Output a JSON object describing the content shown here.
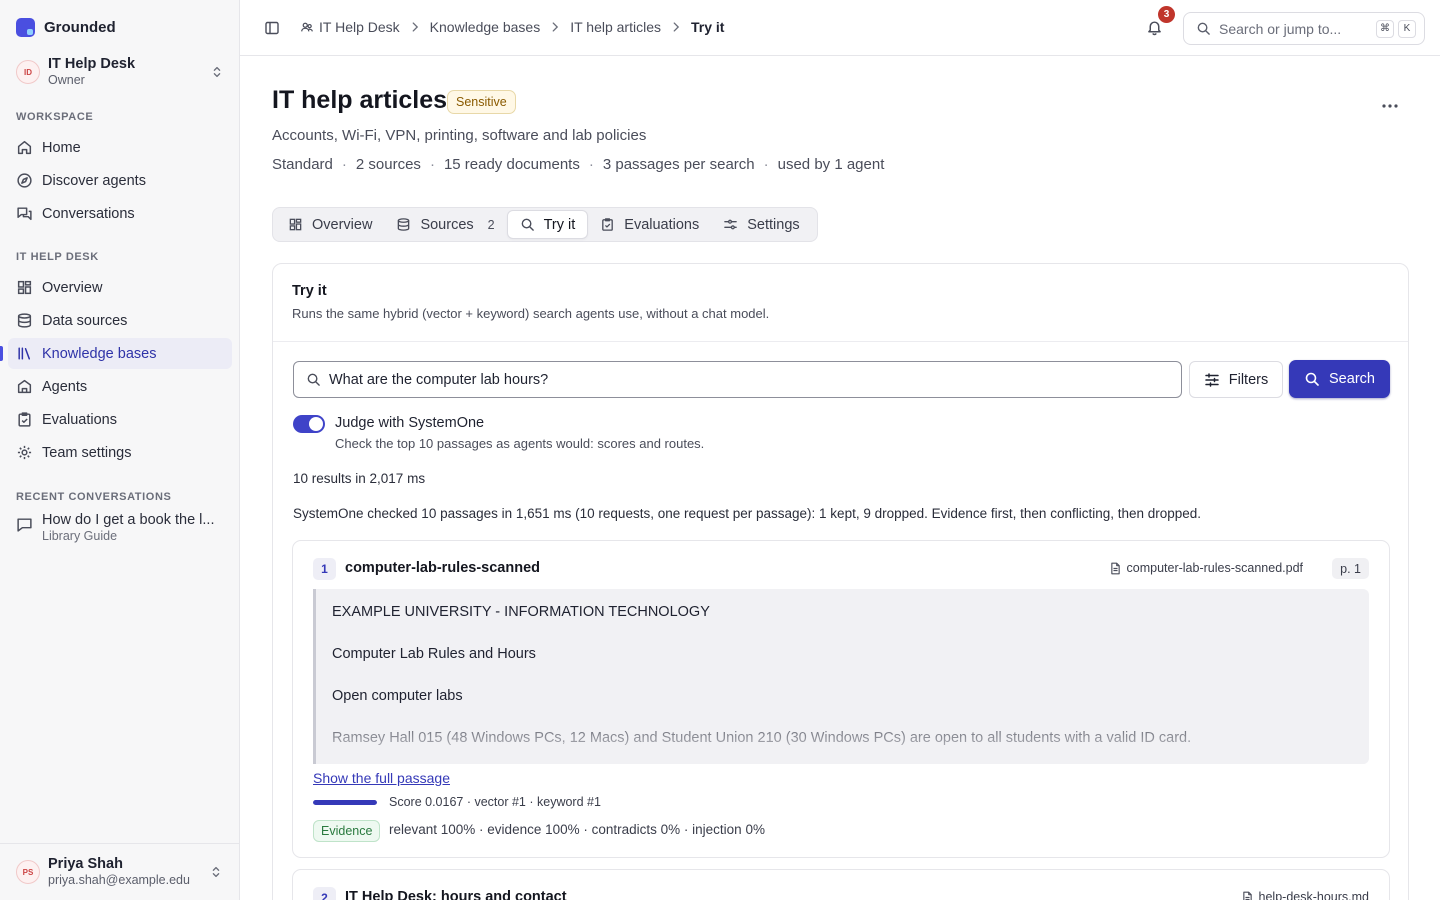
{
  "app": {
    "name": "Grounded"
  },
  "team": {
    "initials": "ID",
    "name": "IT Help Desk",
    "role": "Owner"
  },
  "sidebar": {
    "workspace_title": "WORKSPACE",
    "workspace_items": [
      {
        "label": "Home",
        "icon": "home-icon"
      },
      {
        "label": "Discover agents",
        "icon": "compass-icon"
      },
      {
        "label": "Conversations",
        "icon": "chat-icon"
      }
    ],
    "team_title": "IT HELP DESK",
    "team_items": [
      {
        "label": "Overview",
        "icon": "grid-icon"
      },
      {
        "label": "Data sources",
        "icon": "database-icon"
      },
      {
        "label": "Knowledge bases",
        "icon": "library-icon",
        "active": true
      },
      {
        "label": "Agents",
        "icon": "bot-icon"
      },
      {
        "label": "Evaluations",
        "icon": "clipboard-check-icon"
      },
      {
        "label": "Team settings",
        "icon": "gear-icon"
      }
    ],
    "recent_title": "RECENT CONVERSATIONS",
    "recent": [
      {
        "title": "How do I get a book the l...",
        "agent": "Library Guide"
      }
    ]
  },
  "user": {
    "initials": "PS",
    "name": "Priya Shah",
    "email": "priya.shah@example.edu"
  },
  "breadcrumb": [
    "IT Help Desk",
    "Knowledge bases",
    "IT help articles",
    "Try it"
  ],
  "notifications": {
    "count": "3"
  },
  "search_jump": {
    "placeholder": "Search or jump to...",
    "kbd1": "⌘",
    "kbd2": "K"
  },
  "page": {
    "title": "IT help articles",
    "badge": "Sensitive",
    "description": "Accounts, Wi-Fi, VPN, printing, software and lab policies",
    "meta": [
      "Standard",
      "2 sources",
      "15 ready documents",
      "3 passages per search",
      "used by 1 agent"
    ]
  },
  "tabs": [
    {
      "label": "Overview"
    },
    {
      "label": "Sources",
      "count": "2"
    },
    {
      "label": "Try it",
      "active": true
    },
    {
      "label": "Evaluations"
    },
    {
      "label": "Settings"
    }
  ],
  "try_it": {
    "title": "Try it",
    "subtitle": "Runs the same hybrid (vector + keyword) search agents use, without a chat model.",
    "query": "What are the computer lab hours?",
    "filters_label": "Filters",
    "search_label": "Search",
    "judge_label": "Judge with SystemOne",
    "judge_desc": "Check the top 10 passages as agents would: scores and routes.",
    "judge_enabled": true,
    "result_count": "10 results in 2,017 ms",
    "judge_summary": "SystemOne checked 10 passages in 1,651 ms (10 requests, one request per passage): 1 kept, 9 dropped. Evidence first, then conflicting, then dropped."
  },
  "results": [
    {
      "rank": "1",
      "title": "computer-lab-rules-scanned",
      "file": "computer-lab-rules-scanned.pdf",
      "page": "p. 1",
      "passage": [
        "EXAMPLE UNIVERSITY - INFORMATION TECHNOLOGY",
        "Computer Lab Rules and Hours",
        "Open computer labs",
        "Ramsey Hall 015 (48 Windows PCs, 12 Macs) and Student Union 210 (30 Windows PCs) are open to all students with a valid ID card."
      ],
      "show_full": "Show the full passage",
      "score_fraction": 1.0,
      "score_text": "Score 0.0167 · vector #1 · keyword #1",
      "verdict": "Evidence",
      "judge_scores": "relevant 100% · evidence 100% · contradicts 0% · injection 0%"
    },
    {
      "rank": "2",
      "title": "IT Help Desk: hours and contact",
      "file": "help-desk-hours.md"
    }
  ]
}
